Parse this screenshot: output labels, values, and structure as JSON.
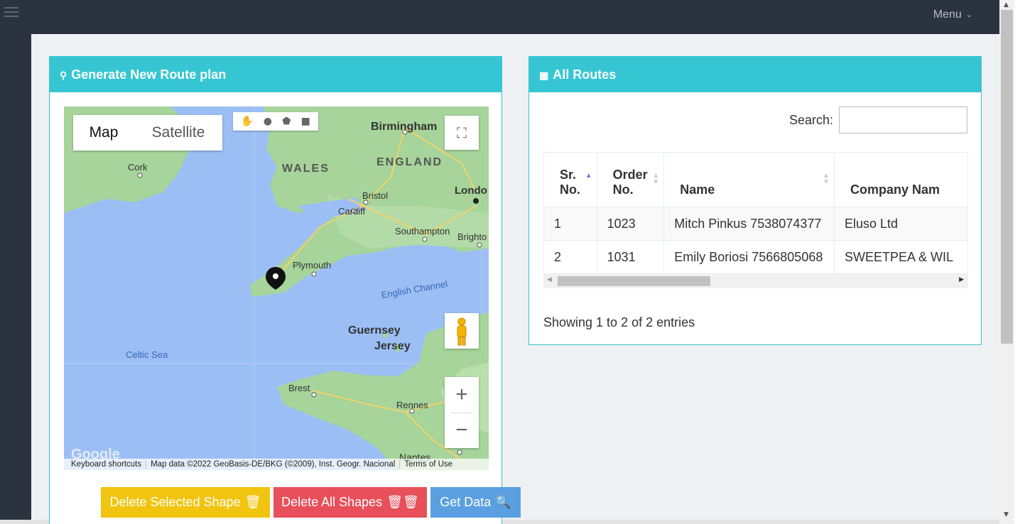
{
  "topbar": {
    "menu_label": "Menu"
  },
  "left_panel": {
    "title": "Generate New Route plan",
    "map": {
      "type_active": "Map",
      "type_other": "Satellite",
      "labels": {
        "birmingham": "Birmingham",
        "england": "ENGLAND",
        "wales": "WALES",
        "cork": "Cork",
        "bristol": "Bristol",
        "london": "Londo",
        "cardiff": "Cardiff",
        "southampton": "Southampton",
        "brighton": "Brighto",
        "plymouth": "Plymouth",
        "english_channel": "English Channel",
        "guernsey": "Guernsey",
        "jersey": "Jersey",
        "celtic_sea": "Celtic Sea",
        "brest": "Brest",
        "rennes": "Rennes",
        "nantes": "Nantes",
        "google": "Google"
      },
      "attribution": {
        "shortcuts": "Keyboard shortcuts",
        "data": "Map data ©2022 GeoBasis-DE/BKG (©2009), Inst. Geogr. Nacional",
        "terms": "Terms of Use"
      }
    },
    "buttons": {
      "delete_selected": "Delete Selected Shape",
      "delete_all": "Delete All Shapes",
      "get_data": "Get Data"
    }
  },
  "right_panel": {
    "title": "All Routes",
    "search_label": "Search:",
    "columns": [
      "Sr. No.",
      "Order No.",
      "Name",
      "Company Nam"
    ],
    "rows": [
      [
        "1",
        "1023",
        "Mitch Pinkus 7538074377",
        "Eluso Ltd"
      ],
      [
        "2",
        "1031",
        "Emily Boriosi 7566805068",
        "SWEETPEA & WIL"
      ]
    ],
    "info": "Showing 1 to 2 of 2 entries"
  },
  "colors": {
    "header": "#36c6d3",
    "topbar": "#2b333e",
    "yellow": "#f1c40f",
    "red": "#e7505a",
    "blue": "#5a9fe0"
  }
}
